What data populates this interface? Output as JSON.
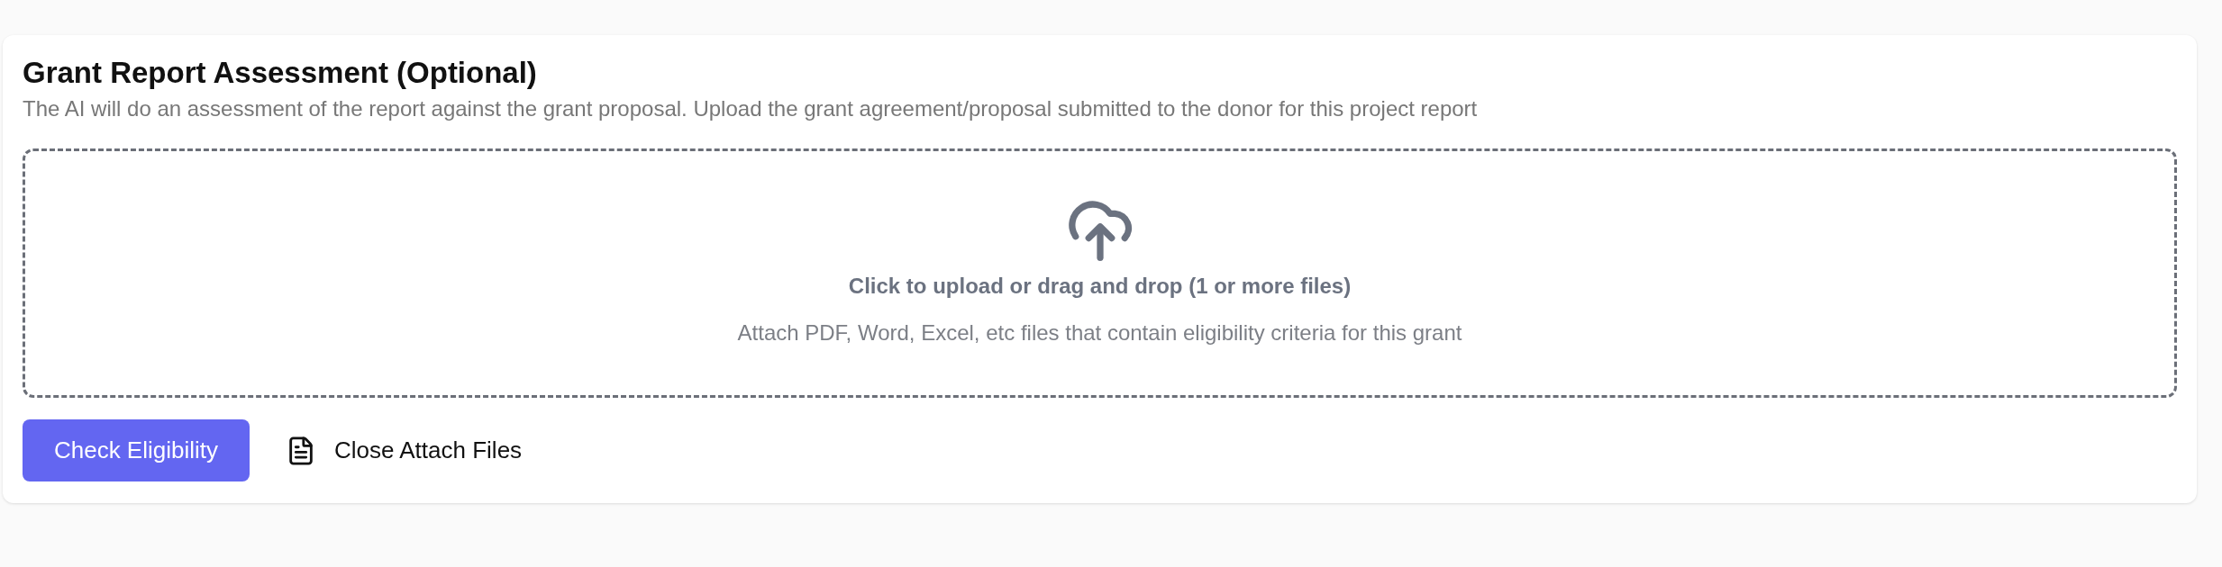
{
  "section": {
    "title": "Grant Report Assessment (Optional)",
    "description": "The AI will do an assessment of the report against the grant proposal. Upload the grant agreement/proposal submitted to the donor for this project report"
  },
  "dropzone": {
    "prompt": "Click to upload or drag and drop (1 or more files)",
    "hint": "Attach PDF, Word, Excel, etc files that contain eligibility criteria for this grant"
  },
  "actions": [
    {
      "kind": "primary",
      "label": "Check Eligibility"
    },
    {
      "kind": "link",
      "label": "Close Attach Files"
    }
  ]
}
